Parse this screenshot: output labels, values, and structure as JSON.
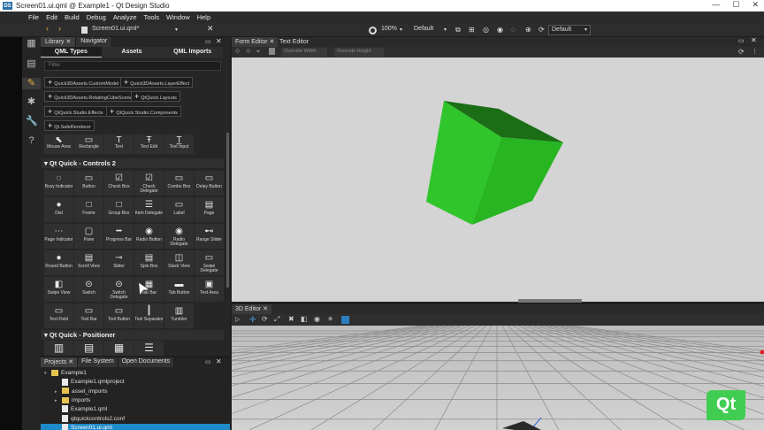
{
  "window": {
    "title": "Screen01.ui.qml @ Example1 - Qt Design Studio",
    "app_icon_label": "DS",
    "controls": [
      "—",
      "☐",
      "✕"
    ]
  },
  "menu": [
    "File",
    "Edit",
    "Build",
    "Debug",
    "Analyze",
    "Tools",
    "Window",
    "Help"
  ],
  "toolbar": {
    "document": "Screen01.ui.qml*",
    "zoom": "100%",
    "state": "Default",
    "style": "Default"
  },
  "library": {
    "tabs": [
      "Library",
      "Navigator"
    ],
    "subtabs": [
      "QML Types",
      "Assets",
      "QML Imports"
    ],
    "filter_placeholder": "Filter",
    "imports": [
      "Quick3DAssets.CustomModel",
      "Quick3DAssets.LayerEffect",
      "Quick3DAssets.RotatingCubeScene",
      "QtQuick.Layouts",
      "QtQuick.Studio.Effects",
      "QtQuick.Studio.Components",
      "Qt.SafeRenderer"
    ],
    "row_top_labels": [
      "Mouse Area",
      "Rectangle",
      "Text",
      "Text Edit",
      "Text Input"
    ],
    "section_controls": "Qt Quick - Controls 2",
    "controls": [
      "Busy Indicator",
      "Button",
      "Check Box",
      "Check Delegate",
      "Combo Box",
      "Delay Button",
      "Dial",
      "Frame",
      "Group Box",
      "Item Delegate",
      "Label",
      "Page",
      "Page Indicator",
      "Pane",
      "Progress Bar",
      "Radio Button",
      "Radio Delegate",
      "Range Slider",
      "Round Button",
      "Scroll View",
      "Slider",
      "Spin Box",
      "Stack View",
      "Swipe Delegate",
      "Swipe View",
      "Switch",
      "Switch Delegate",
      "Tab Bar",
      "Tab Button",
      "Text Area",
      "Text Field",
      "Tool Bar",
      "Tool Button",
      "Tool Separator",
      "Tumbler"
    ],
    "section_positioner": "Qt Quick - Positioner"
  },
  "projects": {
    "tabs": [
      "Projects",
      "File System",
      "Open Documents"
    ],
    "tree": [
      {
        "label": "Example1",
        "type": "folder",
        "depth": 0
      },
      {
        "label": "Example1.qmlproject",
        "type": "file",
        "depth": 1
      },
      {
        "label": "asset_imports",
        "type": "folder",
        "depth": 1
      },
      {
        "label": "imports",
        "type": "folder",
        "depth": 1
      },
      {
        "label": "Example1.qml",
        "type": "file",
        "depth": 1
      },
      {
        "label": "qtquickcontrols2.conf",
        "type": "file",
        "depth": 1
      },
      {
        "label": "Screen01.ui.qml",
        "type": "file",
        "depth": 1,
        "selected": true
      }
    ]
  },
  "form_editor": {
    "tabs": [
      "Form Editor",
      "Text Editor"
    ],
    "override_width": "Override Width",
    "override_height": "Override Height"
  },
  "editor_3d": {
    "tab": "3D Editor"
  },
  "qt_logo": "Qt",
  "colors": {
    "cube_front": "#2fc52b",
    "cube_side": "#22a51d",
    "cube_top": "#1b6e16",
    "qt_green": "#41cd52",
    "selection": "#2d7fc0"
  }
}
